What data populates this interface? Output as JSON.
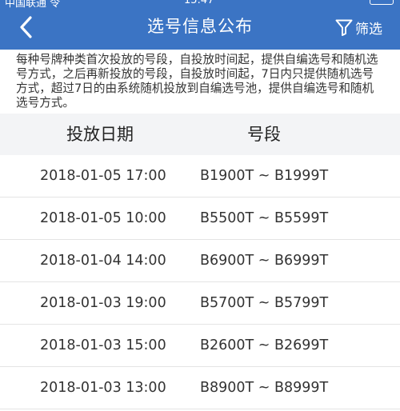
{
  "status_bar": {
    "carrier": "中国联通 令",
    "time": "15:47"
  },
  "header": {
    "title": "选号信息公布",
    "filter_label": "筛选"
  },
  "notice": "每种号牌种类首次投放的号段，自投放时间起，提供自编选号和随机选号方式，之后再新投放的号段，自投放时间起，7日内只提供随机选号方式，超过7日的由系统随机投放到自编选号池，提供自编选号和随机选号方式。",
  "table": {
    "columns": [
      "投放日期",
      "号段"
    ],
    "rows": [
      {
        "date": "2018-01-05 17:00",
        "range": "B1900T ~ B1999T"
      },
      {
        "date": "2018-01-05 10:00",
        "range": "B5500T ~ B5599T"
      },
      {
        "date": "2018-01-04 14:00",
        "range": "B6900T ~ B6999T"
      },
      {
        "date": "2018-01-03 19:00",
        "range": "B5700T ~ B5799T"
      },
      {
        "date": "2018-01-03 15:00",
        "range": "B2600T ~ B2699T"
      },
      {
        "date": "2018-01-03 13:00",
        "range": "B8900T ~ B8999T"
      }
    ]
  },
  "colors": {
    "header_bg": "#3b74c4",
    "table_header_bg": "#f3f4f6",
    "divider": "#e4e4e4"
  },
  "icons": {
    "back": "chevron-left-icon",
    "filter": "funnel-icon"
  }
}
